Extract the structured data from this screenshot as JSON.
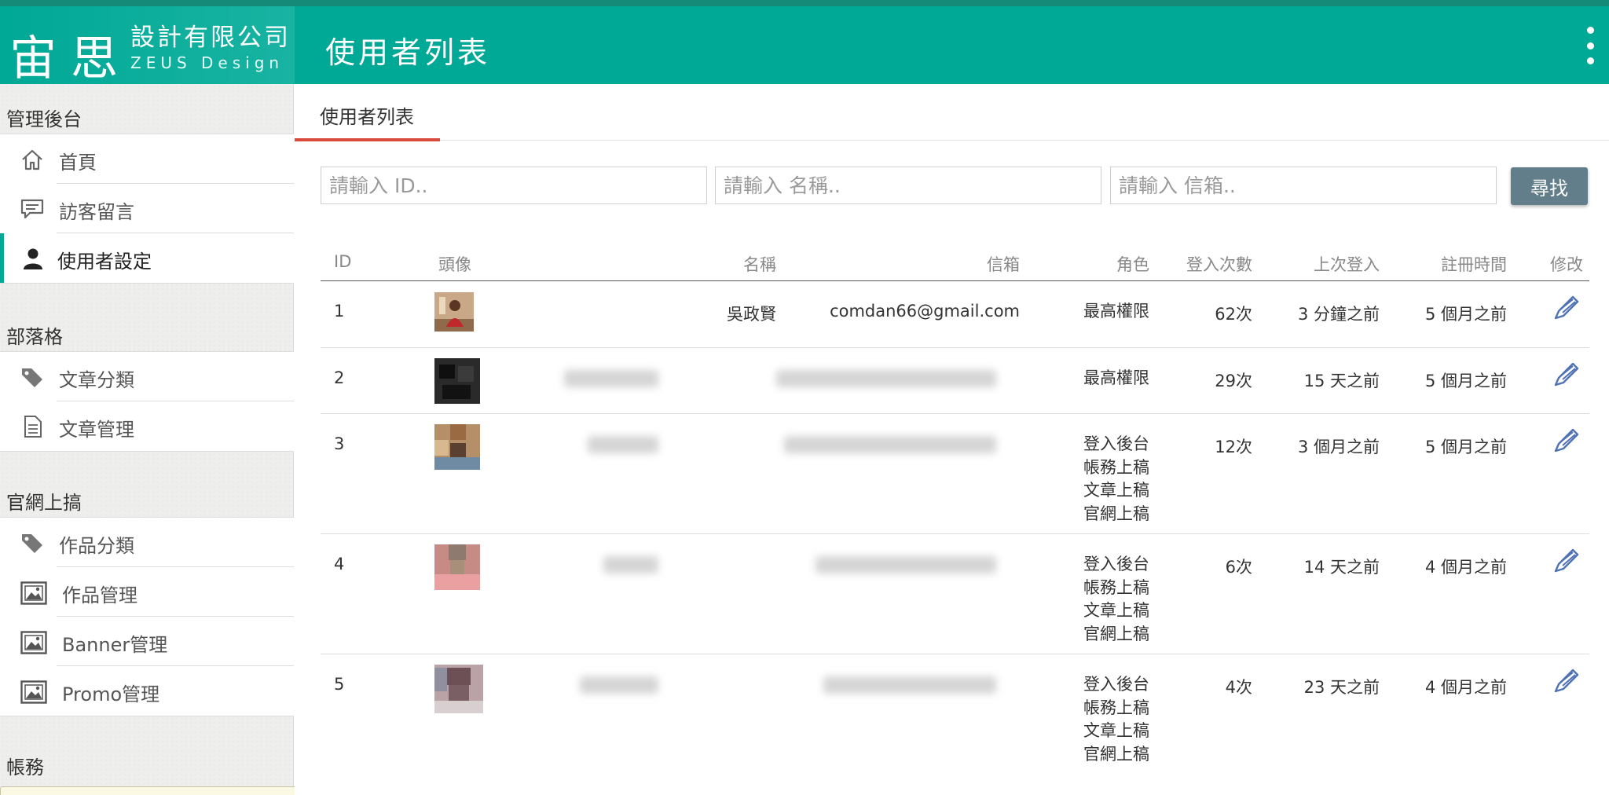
{
  "header": {
    "logo_big": "宙思",
    "logo_company": "設計有限公司",
    "logo_english": "ZEUS Design",
    "page_title": "使用者列表",
    "more_icon": "more-vert-icon",
    "colors": {
      "primary": "#00a896",
      "topline": "#168a78",
      "tab_underline": "#d94a3c",
      "button": "#627e8b",
      "edit_icon": "#4f72b4"
    }
  },
  "sidebar": {
    "sections": [
      {
        "title": "管理後台",
        "items": [
          {
            "label": "首頁",
            "icon": "home-icon"
          },
          {
            "label": "訪客留言",
            "icon": "message-icon"
          },
          {
            "label": "使用者設定",
            "icon": "user-icon",
            "active": true
          }
        ]
      },
      {
        "title": "部落格",
        "items": [
          {
            "label": "文章分類",
            "icon": "tag-icon"
          },
          {
            "label": "文章管理",
            "icon": "document-icon"
          }
        ]
      },
      {
        "title": "官網上搞",
        "items": [
          {
            "label": "作品分類",
            "icon": "tag-icon"
          },
          {
            "label": "作品管理",
            "icon": "image-icon"
          },
          {
            "label": "Banner管理",
            "icon": "image-icon"
          },
          {
            "label": "Promo管理",
            "icon": "image-icon"
          }
        ]
      },
      {
        "title": "帳務",
        "items": []
      }
    ]
  },
  "main": {
    "tab_label": "使用者列表",
    "search": {
      "id_placeholder": "請輸入 ID..",
      "name_placeholder": "請輸入 名稱..",
      "email_placeholder": "請輸入 信箱..",
      "button_label": "尋找"
    },
    "table": {
      "columns": [
        "ID",
        "頭像",
        "名稱",
        "信箱",
        "角色",
        "登入次數",
        "上次登入",
        "註冊時間",
        "修改"
      ],
      "rows": [
        {
          "id": "1",
          "name": "吳政賢",
          "email": "comdan66@gmail.com",
          "roles": [
            "最高權限"
          ],
          "logins": "62次",
          "last_login": "3 分鐘之前",
          "registered": "5 個月之前"
        },
        {
          "id": "2",
          "name": "",
          "email": "",
          "roles": [
            "最高權限"
          ],
          "logins": "29次",
          "last_login": "15 天之前",
          "registered": "5 個月之前"
        },
        {
          "id": "3",
          "name": "",
          "email": "",
          "roles": [
            "登入後台",
            "帳務上稿",
            "文章上稿",
            "官網上稿"
          ],
          "logins": "12次",
          "last_login": "3 個月之前",
          "registered": "5 個月之前"
        },
        {
          "id": "4",
          "name": "",
          "email": "",
          "roles": [
            "登入後台",
            "帳務上稿",
            "文章上稿",
            "官網上稿"
          ],
          "logins": "6次",
          "last_login": "14 天之前",
          "registered": "4 個月之前"
        },
        {
          "id": "5",
          "name": "",
          "email": "",
          "roles": [
            "登入後台",
            "帳務上稿",
            "文章上稿",
            "官網上稿"
          ],
          "logins": "4次",
          "last_login": "23 天之前",
          "registered": "4 個月之前"
        }
      ]
    }
  }
}
